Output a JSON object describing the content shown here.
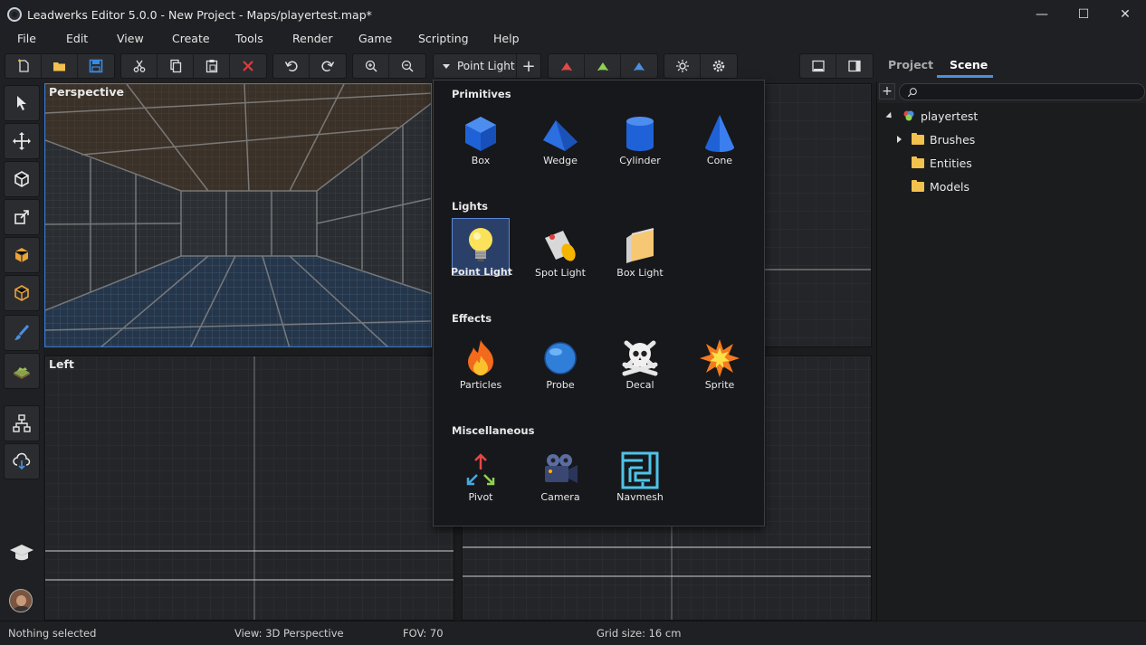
{
  "window": {
    "title": "Leadwerks Editor 5.0.0 - New Project - Maps/playertest.map*",
    "controls": {
      "minimize": "—",
      "maximize": "☐",
      "close": "✕"
    }
  },
  "menu": [
    "File",
    "Edit",
    "View",
    "Create",
    "Tools",
    "Render",
    "Game",
    "Scripting",
    "Help"
  ],
  "toolbar": {
    "object_dropdown": {
      "selected": "Point Light",
      "add_symbol": "+"
    },
    "icons": [
      "new-file-icon",
      "open-folder-icon",
      "save-icon",
      "cut-icon",
      "copy-icon",
      "paste-icon",
      "delete-icon",
      "undo-icon",
      "redo-icon",
      "zoom-in-icon",
      "zoom-out-icon",
      "csg-icon-1",
      "csg-icon-2",
      "csg-icon-3",
      "sun-icon",
      "settings-icon",
      "layout-single-icon",
      "layout-sidebar-icon"
    ]
  },
  "right_tabs": {
    "project": "Project",
    "scene": "Scene",
    "active": "Scene"
  },
  "left_tools": [
    "select-icon",
    "move-icon",
    "rotate-icon",
    "scale-icon",
    "box-create-icon",
    "vertex-icon",
    "paint-brush-icon",
    "terrain-icon",
    "hierarchy-icon",
    "cloud-download-icon",
    "tutorial-cap-icon",
    "user-avatar"
  ],
  "viewports": {
    "perspective": "Perspective",
    "left": "Left"
  },
  "popup": {
    "sections": [
      {
        "title": "Primitives",
        "items": [
          "Box",
          "Wedge",
          "Cylinder",
          "Cone"
        ]
      },
      {
        "title": "Lights",
        "items": [
          "Point Light",
          "Spot Light",
          "Box Light"
        ]
      },
      {
        "title": "Effects",
        "items": [
          "Particles",
          "Probe",
          "Decal",
          "Sprite"
        ]
      },
      {
        "title": "Miscellaneous",
        "items": [
          "Pivot",
          "Camera",
          "Navmesh"
        ]
      }
    ],
    "selected_item": "Point Light"
  },
  "scene_tree": {
    "root": "playertest",
    "children": [
      "Brushes",
      "Entities",
      "Models"
    ]
  },
  "statusbar": {
    "selection": "Nothing selected",
    "view": "View: 3D Perspective",
    "fov": "FOV: 70",
    "grid": "Grid size: 16 cm"
  },
  "colors": {
    "accent": "#4a90e2",
    "selection": "#2b4069",
    "folder": "#f2c14e"
  }
}
